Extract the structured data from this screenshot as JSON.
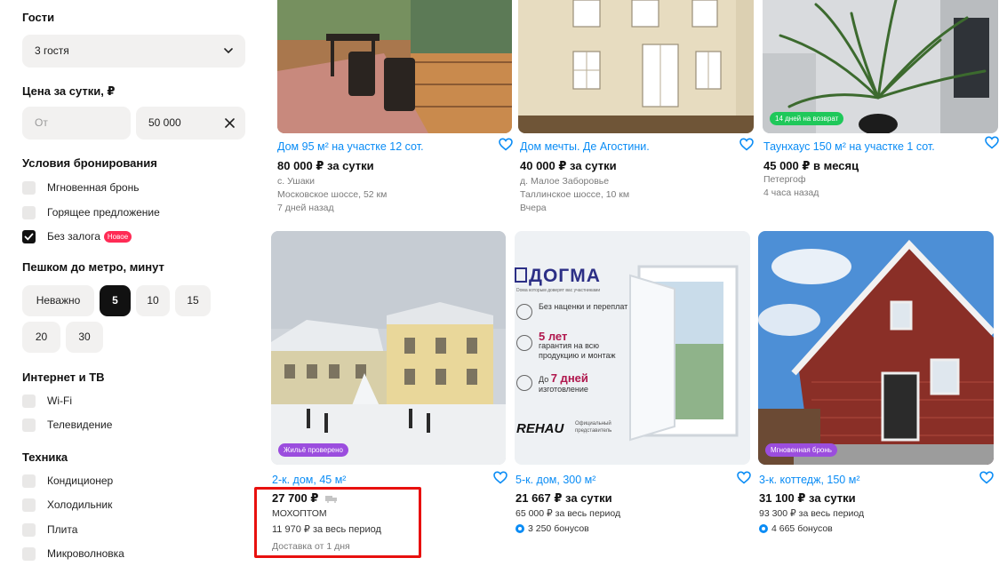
{
  "filters": {
    "guests": {
      "title": "Гости",
      "value": "3 гостя"
    },
    "price": {
      "title": "Цена за сутки, ₽",
      "from_placeholder": "От",
      "to_value": "50 000"
    },
    "booking": {
      "title": "Условия бронирования",
      "options": [
        {
          "label": "Мгновенная бронь",
          "checked": false
        },
        {
          "label": "Горящее предложение",
          "checked": false
        },
        {
          "label": "Без залога",
          "checked": true,
          "badge": "Новое"
        }
      ]
    },
    "metro": {
      "title": "Пешком до метро, минут",
      "chips": [
        "Неважно",
        "5",
        "10",
        "15",
        "20",
        "30"
      ],
      "active": "5"
    },
    "internet": {
      "title": "Интернет и ТВ",
      "options": [
        "Wi-Fi",
        "Телевидение"
      ]
    },
    "tech": {
      "title": "Техника",
      "options": [
        "Кондиционер",
        "Холодильник",
        "Плита",
        "Микроволновка"
      ]
    }
  },
  "listings_top": [
    {
      "title": "Дом 95 м² на участке 12 сот.",
      "price": "80 000 ₽ за сутки",
      "meta": [
        "с. Ушаки",
        "Московское шоссе, 52 км",
        "7 дней назад"
      ]
    },
    {
      "title": "Дом мечты. Де Агостини.",
      "price": "40 000 ₽ за сутки",
      "meta": [
        "д. Малое Заборовье",
        "Таллинское шоссе, 10 км",
        "Вчера"
      ]
    },
    {
      "title": "Таунхаус 150 м² на участке 1 сот.",
      "price": "45 000 ₽ в месяц",
      "meta": [
        "Петергоф",
        "4 часа назад"
      ],
      "badge": "14 дней на возврат"
    }
  ],
  "listings_bottom": [
    {
      "title": "2-к. дом, 45 м²",
      "price": "27 700 ₽",
      "seller": "МОХОПТОМ",
      "period": "11 970 ₽ за весь период",
      "delivery": "Доставка от 1 дня",
      "badge": "Жильё проверено"
    },
    {
      "title": "5-к. дом, 300 м²",
      "price": "21 667 ₽ за сутки",
      "period": "65 000 ₽ за весь период",
      "bonus": "3 250 бонусов",
      "ad": {
        "brand": "ДОГМА",
        "tagline": "Dома которым доверят вас участниками",
        "p1": "Без наценки и переплат",
        "p2_big": "5 лет",
        "p2": "гарантия на всю продукцию и монтаж",
        "p3_pre": "До",
        "p3_big": "7 дней",
        "p3": "изготовление",
        "rehau": "REHAU",
        "rehau_sub": "Официальный представитель"
      }
    },
    {
      "title": "3-к. коттедж, 150 м²",
      "price": "31 100 ₽ за сутки",
      "period": "93 300 ₽ за весь период",
      "bonus": "4 665 бонусов",
      "badge": "Мгновенная бронь"
    }
  ],
  "colors": {
    "link": "#0a8cf5",
    "highlight": "#e8100e",
    "badge_green": "#1fc85a",
    "badge_purple": "#9b4dde",
    "badge_new": "#ff2b55"
  }
}
